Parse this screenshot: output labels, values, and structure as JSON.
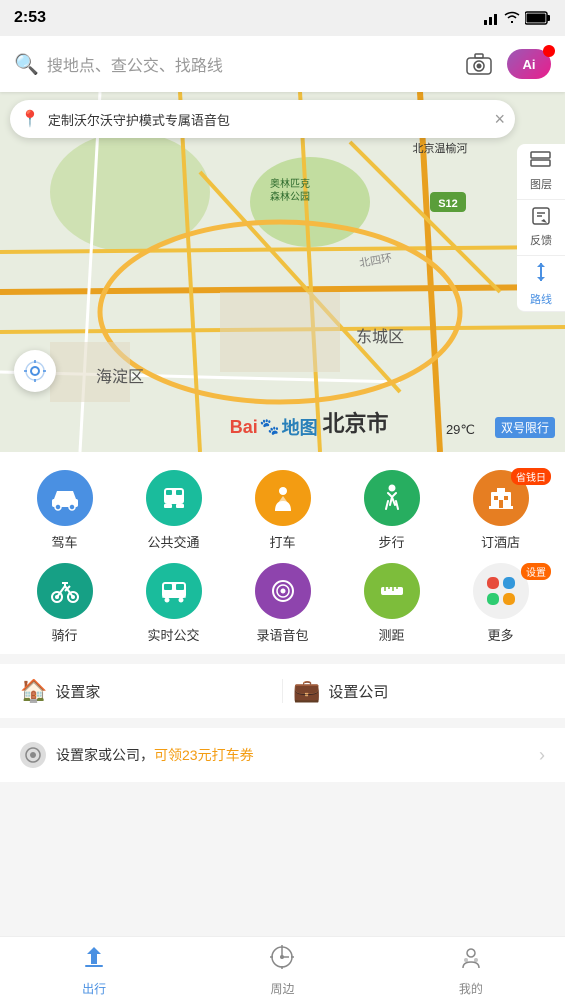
{
  "statusBar": {
    "time": "2:53",
    "icons": [
      "signal",
      "wifi",
      "battery"
    ]
  },
  "searchBar": {
    "placeholder": "搜地点、查公交、找路线",
    "cameraIcon": "📷",
    "aiLabel": "Ai"
  },
  "notification": {
    "text": "定制沃尔沃守护模式专属语音包",
    "closeIcon": "×"
  },
  "mapControls": [
    {
      "icon": "⊞",
      "label": "图层"
    },
    {
      "icon": "✏",
      "label": "反馈"
    },
    {
      "icon": "↑↓",
      "label": "路线"
    }
  ],
  "mapInfo": {
    "temperature": "29℃",
    "restriction": "双号限行",
    "cityName": "北京市"
  },
  "funcGrid": [
    {
      "id": "drive",
      "label": "驾车",
      "icon": "🚗",
      "colorClass": "icon-blue",
      "badge": null
    },
    {
      "id": "transit",
      "label": "公共交通",
      "icon": "🚌",
      "colorClass": "icon-teal",
      "badge": null
    },
    {
      "id": "taxi",
      "label": "打车",
      "icon": "🏃",
      "colorClass": "icon-orange",
      "badge": null
    },
    {
      "id": "walk",
      "label": "步行",
      "icon": "🚶",
      "colorClass": "icon-green",
      "badge": null
    },
    {
      "id": "hotel",
      "label": "订酒店",
      "icon": "🏨",
      "colorClass": "icon-orange2",
      "badge": "省钱日"
    },
    {
      "id": "bike",
      "label": "骑行",
      "icon": "🚲",
      "colorClass": "icon-cyan",
      "badge": null
    },
    {
      "id": "realbus",
      "label": "实时公交",
      "icon": "🚍",
      "colorClass": "icon-teal2",
      "badge": null
    },
    {
      "id": "voice",
      "label": "录语音包",
      "icon": "⏺",
      "colorClass": "icon-purple",
      "badge": null
    },
    {
      "id": "measure",
      "label": "测距",
      "icon": "📏",
      "colorClass": "icon-yellow-green",
      "badge": null
    },
    {
      "id": "more",
      "label": "更多",
      "icon": "more",
      "colorClass": "icon-multi",
      "badge": "设置"
    }
  ],
  "quickLinks": [
    {
      "id": "home",
      "icon": "🏠",
      "label": "设置家",
      "iconColor": "#f39c12"
    },
    {
      "id": "company",
      "icon": "💼",
      "label": "设置公司",
      "iconColor": "#3498db"
    }
  ],
  "promoBar": {
    "text": "设置家或公司，",
    "highlight": "可领23元打车券",
    "icon": "⚙"
  },
  "bottomTabs": [
    {
      "id": "travel",
      "label": "出行",
      "icon": "🚗",
      "active": true
    },
    {
      "id": "nearby",
      "label": "周边",
      "icon": "🧭",
      "active": false
    },
    {
      "id": "mine",
      "label": "我的",
      "icon": "👤",
      "active": false
    }
  ]
}
